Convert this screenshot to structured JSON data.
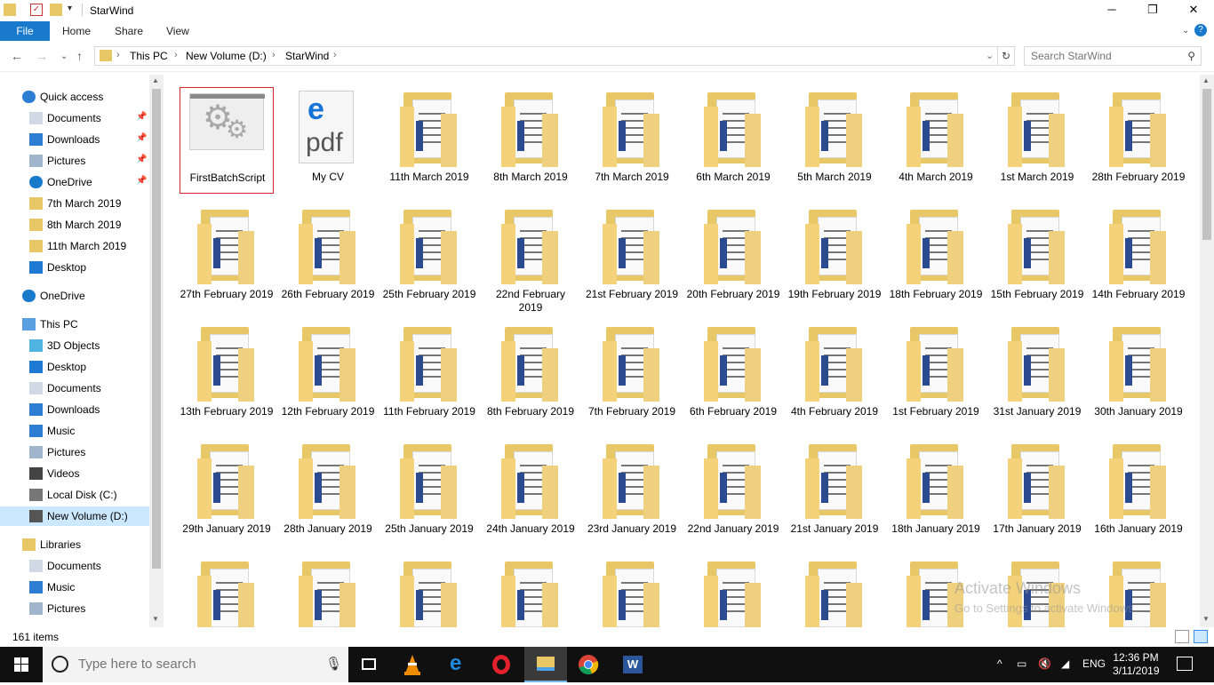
{
  "window": {
    "title": "StarWind",
    "minimize": "─",
    "maximize": "❐",
    "close": "✕"
  },
  "ribbon": {
    "tabs": [
      "File",
      "Home",
      "Share",
      "View"
    ]
  },
  "address": {
    "crumbs": [
      "This PC",
      "New Volume (D:)",
      "StarWind"
    ],
    "search_placeholder": "Search StarWind"
  },
  "nav": {
    "items": [
      {
        "label": "Quick access",
        "icon": "star-icon",
        "pinned": false,
        "indent": 1
      },
      {
        "label": "Documents",
        "icon": "documents-icon",
        "pinned": true,
        "indent": 2
      },
      {
        "label": "Downloads",
        "icon": "download-icon",
        "pinned": true,
        "indent": 2
      },
      {
        "label": "Pictures",
        "icon": "pictures-icon",
        "pinned": true,
        "indent": 2
      },
      {
        "label": "OneDrive",
        "icon": "cloud-icon",
        "pinned": true,
        "indent": 2
      },
      {
        "label": "7th March 2019",
        "icon": "folder-icon",
        "pinned": false,
        "indent": 2
      },
      {
        "label": "8th March 2019",
        "icon": "folder-icon",
        "pinned": false,
        "indent": 2
      },
      {
        "label": "11th March 2019",
        "icon": "folder-icon",
        "pinned": false,
        "indent": 2
      },
      {
        "label": "Desktop",
        "icon": "desktop-icon",
        "pinned": false,
        "indent": 2
      },
      {
        "label": "OneDrive",
        "icon": "cloud-icon",
        "pinned": false,
        "indent": 1
      },
      {
        "label": "This PC",
        "icon": "computer-icon",
        "pinned": false,
        "indent": 1
      },
      {
        "label": "3D Objects",
        "icon": "cube-icon",
        "pinned": false,
        "indent": 2
      },
      {
        "label": "Desktop",
        "icon": "desktop-icon",
        "pinned": false,
        "indent": 2
      },
      {
        "label": "Documents",
        "icon": "documents-icon",
        "pinned": false,
        "indent": 2
      },
      {
        "label": "Downloads",
        "icon": "download-icon",
        "pinned": false,
        "indent": 2
      },
      {
        "label": "Music",
        "icon": "music-icon",
        "pinned": false,
        "indent": 2
      },
      {
        "label": "Pictures",
        "icon": "pictures-icon",
        "pinned": false,
        "indent": 2
      },
      {
        "label": "Videos",
        "icon": "video-icon",
        "pinned": false,
        "indent": 2
      },
      {
        "label": "Local Disk (C:)",
        "icon": "disk-icon",
        "pinned": false,
        "indent": 2
      },
      {
        "label": "New Volume (D:)",
        "icon": "drive-icon",
        "pinned": false,
        "indent": 2,
        "selected": true
      },
      {
        "label": "Libraries",
        "icon": "library-icon",
        "pinned": false,
        "indent": 1
      },
      {
        "label": "Documents",
        "icon": "documents-icon",
        "pinned": false,
        "indent": 2
      },
      {
        "label": "Music",
        "icon": "music-icon",
        "pinned": false,
        "indent": 2
      },
      {
        "label": "Pictures",
        "icon": "pictures-icon",
        "pinned": false,
        "indent": 2
      }
    ]
  },
  "files": [
    {
      "name": "FirstBatchScript",
      "type": "batch",
      "selected": true
    },
    {
      "name": "My CV",
      "type": "pdf"
    },
    {
      "name": "11th March 2019",
      "type": "folder"
    },
    {
      "name": "8th March 2019",
      "type": "folder"
    },
    {
      "name": "7th March 2019",
      "type": "folder"
    },
    {
      "name": "6th March 2019",
      "type": "folder"
    },
    {
      "name": "5th March 2019",
      "type": "folder"
    },
    {
      "name": "4th March 2019",
      "type": "folder"
    },
    {
      "name": "1st March 2019",
      "type": "folder"
    },
    {
      "name": "28th February 2019",
      "type": "folder"
    },
    {
      "name": "27th February 2019",
      "type": "folder"
    },
    {
      "name": "26th February 2019",
      "type": "folder"
    },
    {
      "name": "25th February 2019",
      "type": "folder"
    },
    {
      "name": "22nd February 2019",
      "type": "folder"
    },
    {
      "name": "21st February 2019",
      "type": "folder"
    },
    {
      "name": "20th February 2019",
      "type": "folder"
    },
    {
      "name": "19th February 2019",
      "type": "folder"
    },
    {
      "name": "18th February 2019",
      "type": "folder"
    },
    {
      "name": "15th February 2019",
      "type": "folder"
    },
    {
      "name": "14th February 2019",
      "type": "folder"
    },
    {
      "name": "13th February 2019",
      "type": "folder"
    },
    {
      "name": "12th February 2019",
      "type": "folder"
    },
    {
      "name": "11th February 2019",
      "type": "folder"
    },
    {
      "name": "8th February 2019",
      "type": "folder"
    },
    {
      "name": "7th February 2019",
      "type": "folder"
    },
    {
      "name": "6th February 2019",
      "type": "folder"
    },
    {
      "name": "4th February 2019",
      "type": "folder"
    },
    {
      "name": "1st February 2019",
      "type": "folder"
    },
    {
      "name": "31st January 2019",
      "type": "folder"
    },
    {
      "name": "30th January 2019",
      "type": "folder"
    },
    {
      "name": "29th January 2019",
      "type": "folder"
    },
    {
      "name": "28th January 2019",
      "type": "folder"
    },
    {
      "name": "25th January 2019",
      "type": "folder"
    },
    {
      "name": "24th January 2019",
      "type": "folder"
    },
    {
      "name": "23rd January 2019",
      "type": "folder"
    },
    {
      "name": "22nd January 2019",
      "type": "folder"
    },
    {
      "name": "21st January 2019",
      "type": "folder"
    },
    {
      "name": "18th January 2019",
      "type": "folder"
    },
    {
      "name": "17th January 2019",
      "type": "folder"
    },
    {
      "name": "16th January 2019",
      "type": "folder"
    },
    {
      "name": "",
      "type": "folder"
    },
    {
      "name": "",
      "type": "folder"
    },
    {
      "name": "",
      "type": "folder"
    },
    {
      "name": "",
      "type": "folder"
    },
    {
      "name": "",
      "type": "folder"
    },
    {
      "name": "",
      "type": "folder"
    },
    {
      "name": "",
      "type": "folder"
    },
    {
      "name": "",
      "type": "folder"
    },
    {
      "name": "",
      "type": "folder"
    },
    {
      "name": "",
      "type": "folder"
    }
  ],
  "watermark": {
    "line1": "Activate Windows",
    "line2": "Go to Settings to activate Windows."
  },
  "status": {
    "item_count": "161 items"
  },
  "taskbar": {
    "search_placeholder": "Type here to search",
    "apps": [
      "task-view-icon",
      "vlc-icon",
      "edge-icon",
      "opera-icon",
      "file-explorer-icon",
      "chrome-icon",
      "word-icon"
    ],
    "language": "ENG",
    "time": "12:36 PM",
    "date": "3/11/2019"
  },
  "colors": {
    "accent": "#1979ca",
    "selection": "#cce8ff",
    "selected_border": "#d9242a",
    "folder": "#e8c766"
  }
}
